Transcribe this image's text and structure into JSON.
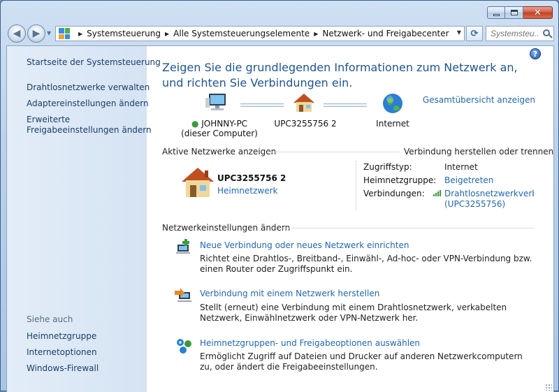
{
  "window": {
    "caption": {
      "minimize": "",
      "maximize": "",
      "close": "✕"
    }
  },
  "address_bar": {
    "crumbs": [
      "Systemsteuerung",
      "Alle Systemsteuerungselemente",
      "Netzwerk- und Freigabecenter"
    ],
    "search_placeholder": "Systemsteu..."
  },
  "sidebar": {
    "links": [
      "Startseite der Systemsteuerung",
      "Drahtlosnetzwerke verwalten",
      "Adaptereinstellungen ändern",
      "Erweiterte",
      "Freigabeeinstellungen ändern"
    ],
    "see_also_heading": "Siehe auch",
    "see_also": [
      "Heimnetzgruppe",
      "Internetoptionen",
      "Windows-Firewall"
    ]
  },
  "main": {
    "help": "?",
    "title": "Zeigen Sie die grundlegenden Informationen zum Netzwerk an, und richten Sie Verbindungen ein.",
    "full_map_link": "Gesamtübersicht anzeigen",
    "nodes": {
      "computer_name": "JOHNNY-PC",
      "computer_sub": "(dieser Computer)",
      "network": "UPC3255756  2",
      "internet": "Internet"
    },
    "active_networks_label": "Aktive Netzwerke anzeigen",
    "connect_disconnect_link": "Verbindung herstellen oder trennen",
    "active_network": {
      "name": "UPC3255756  2",
      "type": "Heimnetzwerk",
      "access_label": "Zugriffstyp:",
      "access_value": "Internet",
      "homegroup_label": "Heimnetzgruppe:",
      "homegroup_value": "Beigetreten",
      "connections_label": "Verbindungen:",
      "connection_value": "Drahtlosnetzwerkverbind",
      "connection_sub": "(UPC3255756)"
    },
    "change_settings_label": "Netzwerkeinstellungen ändern",
    "tasks": [
      {
        "title": "Neue Verbindung oder neues Netzwerk einrichten",
        "desc": "Richtet eine Drahtlos-, Breitband-, Einwähl-, Ad-hoc- oder VPN-Verbindung bzw. einen Router oder Zugriffspunkt ein."
      },
      {
        "title": "Verbindung mit einem Netzwerk herstellen",
        "desc": "Stellt (erneut) eine Verbindung mit einem Drahtlosnetzwerk, verkabelten Netzwerk, Einwählnetzwerk oder VPN-Netzwerk her."
      },
      {
        "title": "Heimnetzgruppen- und Freigabeoptionen auswählen",
        "desc": "Ermöglicht Zugriff auf Dateien und Drucker auf anderen Netzwerkcomputern zu, oder ändert die Freigabeeinstellungen."
      }
    ]
  },
  "colors": {
    "link": "#1f67b5",
    "title": "#1e5494",
    "sidebar_bg": "#dce8f5"
  },
  "icons": [
    "back-arrow-icon",
    "forward-arrow-icon",
    "control-panel-icon",
    "refresh-icon",
    "search-icon",
    "help-icon",
    "computer-icon",
    "house-icon",
    "globe-icon",
    "signal-bars-icon",
    "new-connection-icon",
    "connect-network-icon",
    "homegroup-icon"
  ]
}
